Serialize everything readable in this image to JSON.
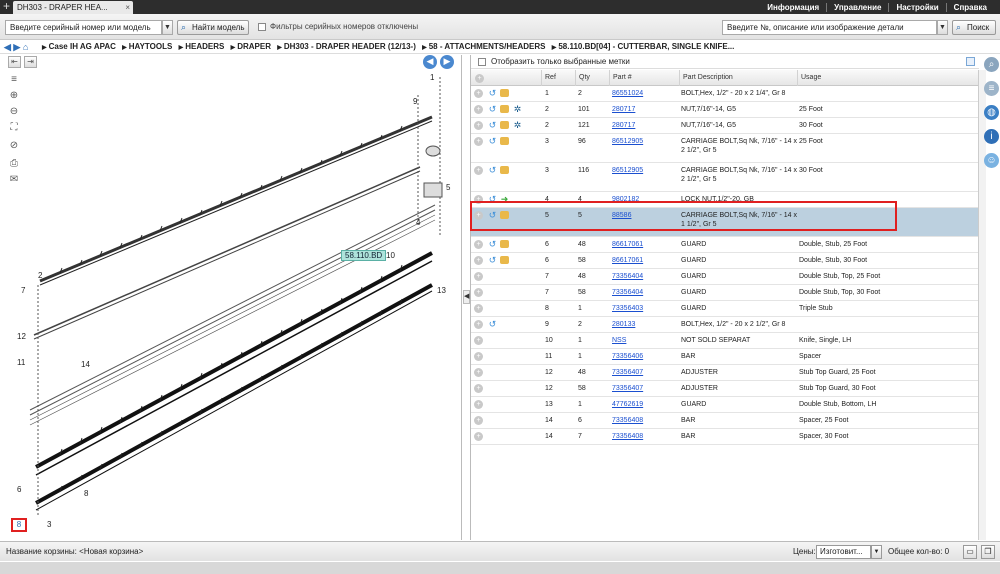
{
  "window": {
    "tab_title": "DH303 - DRAPER HEA...",
    "tab_close": "×",
    "new_tab": "+",
    "menu": [
      "Информация",
      "Управление",
      "Настройки",
      "Справка"
    ]
  },
  "search": {
    "serial_placeholder": "Введите серийный номер или модель",
    "find_model_label": "Найти модель",
    "serial_filter_label": "Фильтры серийных номеров отключены",
    "part_search_placeholder": "Введите №, описание или изображение детали",
    "search_label": "Поиск"
  },
  "breadcrumb": [
    "Case IH AG APAC",
    "HAYTOOLS",
    "HEADERS",
    "DRAPER",
    "DH303 - DRAPER HEADER (12/13-)",
    "58 - ATTACHMENTS/HEADERS",
    "58.110.BD[04] - CUTTERBAR, SINGLE KNIFE..."
  ],
  "diagram": {
    "callout": "58.110.BD",
    "labels": [
      "1",
      "9",
      "5",
      "4",
      "2",
      "7",
      "10",
      "13",
      "12",
      "11",
      "14",
      "6",
      "8",
      "3"
    ],
    "page_number": "8"
  },
  "table": {
    "filter_label": "Отобразить только выбранные метки",
    "columns": [
      "Ref",
      "Qty",
      "Part #",
      "Part Description",
      "Usage"
    ],
    "rows": [
      {
        "ref": "1",
        "qty": "2",
        "part": "86551024",
        "desc": "BOLT,Hex, 1/2\" - 20 x 2 1/4\", Gr 8",
        "usage": "",
        "icons": [
          "plus",
          "arrow",
          "box"
        ],
        "lines": 1,
        "selected": false
      },
      {
        "ref": "2",
        "qty": "101",
        "part": "280717",
        "desc": "NUT,7/16\"-14, G5",
        "usage": "25 Foot",
        "icons": [
          "plus",
          "arrow",
          "box",
          "gear"
        ],
        "lines": 1,
        "selected": false
      },
      {
        "ref": "2",
        "qty": "121",
        "part": "280717",
        "desc": "NUT,7/16\"-14, G5",
        "usage": "30 Foot",
        "icons": [
          "plus",
          "arrow",
          "box",
          "gear"
        ],
        "lines": 1,
        "selected": false
      },
      {
        "ref": "3",
        "qty": "96",
        "part": "86512905",
        "desc": "CARRIAGE BOLT,Sq Nk, 7/16\" - 14 x 2 1/2\", Gr 5",
        "usage": "25 Foot",
        "icons": [
          "plus",
          "arrow",
          "box"
        ],
        "lines": 2,
        "selected": false
      },
      {
        "ref": "3",
        "qty": "116",
        "part": "86512905",
        "desc": "CARRIAGE BOLT,Sq Nk, 7/16\" - 14 x 2 1/2\", Gr 5",
        "usage": "30 Foot",
        "icons": [
          "plus",
          "arrow",
          "box"
        ],
        "lines": 2,
        "selected": false
      },
      {
        "ref": "4",
        "qty": "4",
        "part": "9802182",
        "desc": "LOCK NUT,1/2\"-20, GB",
        "usage": "",
        "icons": [
          "plus",
          "arrow",
          "green"
        ],
        "lines": 1,
        "selected": false
      },
      {
        "ref": "5",
        "qty": "5",
        "part": "88586",
        "desc": "CARRIAGE BOLT,Sq Nk, 7/16\" - 14 x 1 1/2\", Gr 5",
        "usage": "",
        "icons": [
          "plus",
          "arrow",
          "box"
        ],
        "lines": 2,
        "selected": true
      },
      {
        "ref": "6",
        "qty": "48",
        "part": "86617061",
        "desc": "GUARD",
        "usage": "Double, Stub, 25 Foot",
        "icons": [
          "plus",
          "arrow",
          "box"
        ],
        "lines": 1,
        "selected": false
      },
      {
        "ref": "6",
        "qty": "58",
        "part": "86617061",
        "desc": "GUARD",
        "usage": "Double, Stub, 30 Foot",
        "icons": [
          "plus",
          "arrow",
          "box"
        ],
        "lines": 1,
        "selected": false
      },
      {
        "ref": "7",
        "qty": "48",
        "part": "73356404",
        "desc": "GUARD",
        "usage": "Double Stub, Top, 25 Foot",
        "icons": [
          "plus"
        ],
        "lines": 1,
        "selected": false
      },
      {
        "ref": "7",
        "qty": "58",
        "part": "73356404",
        "desc": "GUARD",
        "usage": "Double Stub, Top, 30 Foot",
        "icons": [
          "plus"
        ],
        "lines": 1,
        "selected": false
      },
      {
        "ref": "8",
        "qty": "1",
        "part": "73356403",
        "desc": "GUARD",
        "usage": "Triple Stub",
        "icons": [
          "plus"
        ],
        "lines": 1,
        "selected": false
      },
      {
        "ref": "9",
        "qty": "2",
        "part": "280133",
        "desc": "BOLT,Hex, 1/2\" - 20 x 2 1/2\", Gr 8",
        "usage": "",
        "icons": [
          "plus",
          "arrow"
        ],
        "lines": 1,
        "selected": false
      },
      {
        "ref": "10",
        "qty": "1",
        "part": "NSS",
        "desc": "NOT SOLD SEPARAT",
        "usage": "Knife, Single, LH",
        "icons": [
          "plus"
        ],
        "lines": 1,
        "selected": false
      },
      {
        "ref": "11",
        "qty": "1",
        "part": "73356406",
        "desc": "BAR",
        "usage": "Spacer",
        "icons": [
          "plus"
        ],
        "lines": 1,
        "selected": false
      },
      {
        "ref": "12",
        "qty": "48",
        "part": "73356407",
        "desc": "ADJUSTER",
        "usage": "Stub Top Guard, 25 Foot",
        "icons": [
          "plus"
        ],
        "lines": 1,
        "selected": false
      },
      {
        "ref": "12",
        "qty": "58",
        "part": "73356407",
        "desc": "ADJUSTER",
        "usage": "Stub Top Guard, 30 Foot",
        "icons": [
          "plus"
        ],
        "lines": 1,
        "selected": false
      },
      {
        "ref": "13",
        "qty": "1",
        "part": "47762619",
        "desc": "GUARD",
        "usage": "Double Stub, Bottom, LH",
        "icons": [
          "plus"
        ],
        "lines": 1,
        "selected": false
      },
      {
        "ref": "14",
        "qty": "6",
        "part": "73356408",
        "desc": "BAR",
        "usage": "Spacer, 25 Foot",
        "icons": [
          "plus"
        ],
        "lines": 1,
        "selected": false
      },
      {
        "ref": "14",
        "qty": "7",
        "part": "73356408",
        "desc": "BAR",
        "usage": "Spacer, 30 Foot",
        "icons": [
          "plus"
        ],
        "lines": 1,
        "selected": false
      }
    ]
  },
  "footer": {
    "cart_label": "Название корзины:",
    "cart_value": "<Новая корзина>",
    "prices_label": "Цены:",
    "prices_value": "Изготовит...",
    "total_label": "Общее кол-во: 0"
  }
}
